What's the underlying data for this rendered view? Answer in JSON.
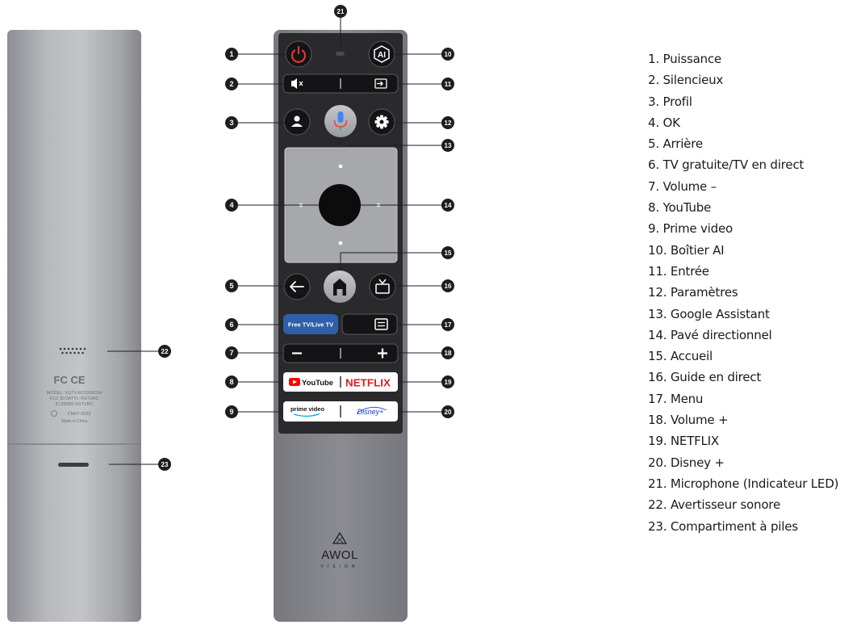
{
  "labels": [
    {
      "num": "1",
      "text": "Puissance"
    },
    {
      "num": "2",
      "text": "Silencieux"
    },
    {
      "num": "3",
      "text": "Profil"
    },
    {
      "num": "4",
      "text": "OK"
    },
    {
      "num": "5",
      "text": "Arrière"
    },
    {
      "num": "6",
      "text": "TV gratuite/TV en direct"
    },
    {
      "num": "7",
      "text": "Volume –"
    },
    {
      "num": "8",
      "text": "YouTube"
    },
    {
      "num": "9",
      "text": "Prime video"
    },
    {
      "num": "10",
      "text": "Boîtier AI"
    },
    {
      "num": "11",
      "text": "Entrée"
    },
    {
      "num": "12",
      "text": "Paramètres"
    },
    {
      "num": "13",
      "text": "Google Assistant"
    },
    {
      "num": "14",
      "text": "Pavé directionnel"
    },
    {
      "num": "15",
      "text": "Accueil"
    },
    {
      "num": "16",
      "text": "Guide en direct"
    },
    {
      "num": "17",
      "text": "Menu"
    },
    {
      "num": "18",
      "text": "Volume +"
    },
    {
      "num": "19",
      "text": "NETFLIX"
    },
    {
      "num": "20",
      "text": "Disney +"
    },
    {
      "num": "21",
      "text": "Microphone (Indicateur LED)"
    },
    {
      "num": "22",
      "text": "Avertisseur sonore"
    },
    {
      "num": "23",
      "text": "Compartiment à piles"
    }
  ],
  "remote": {
    "free_tv_label": "Free TV/Live TV",
    "youtube_label": "YouTube",
    "netflix_label": "NETFLIX",
    "prime_label": "prime video",
    "disney_label": "Disney+",
    "brand_name": "AWOL",
    "brand_sub": "VISION"
  },
  "back_label": {
    "fcc_marks": "FC CE",
    "model_line": "MODEL: VGTV-RC03/RC04",
    "fcc_id_line": "FCC ID:2ATYL-VGTVRC",
    "ic_line": "IC:26099-VGTVRC",
    "cmiit_line": "CMIIT-2023",
    "origin_line": "Made in China"
  },
  "colors": {
    "badge": "#1e1e1e",
    "remote_body": "#84858c",
    "face_panel": "#2a2a2c",
    "power_red": "#e8352f",
    "free_tv_blue": "#2f5fa8",
    "netflix_red": "#d81f26",
    "youtube_red": "#ff0000"
  }
}
